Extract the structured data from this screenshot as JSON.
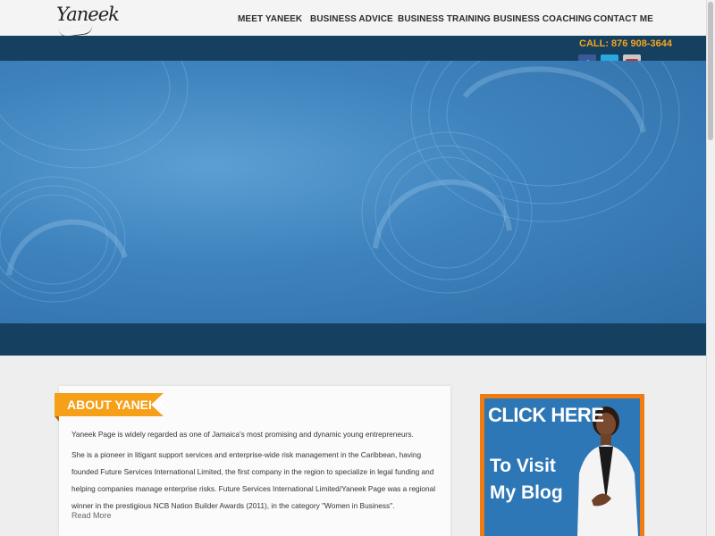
{
  "header": {
    "logo_text": "Yaneek",
    "nav": [
      {
        "label": "MEET YANEEK"
      },
      {
        "label": "BUSINESS ADVICE"
      },
      {
        "label": "BUSINESS TRAINING"
      },
      {
        "label": "BUSINESS COACHING"
      },
      {
        "label": "CONTACT ME"
      }
    ]
  },
  "topbar": {
    "phone": "CALL: 876 908-3644",
    "social": [
      {
        "icon": "facebook-icon",
        "glyph": "f"
      },
      {
        "icon": "twitter-icon",
        "glyph": "t"
      },
      {
        "icon": "youtube-icon",
        "glyph": "You"
      }
    ]
  },
  "about": {
    "heading": "ABOUT YANEEK",
    "paragraph1": "Yaneek Page is widely regarded as one of Jamaica's most promising and dynamic young entrepreneurs.",
    "paragraph2": "She is a pioneer in litigant support services and enterprise-wide risk management in the Caribbean, having founded Future Services International Limited, the first company in the region to specialize in legal funding and helping companies manage enterprise risks. Future Services International Limited/Yaneek Page was a regional winner in the prestigious NCB Nation Builder Awards (2011), in the category \"Women in Business\".",
    "read_more": "Read More"
  },
  "blog_banner": {
    "line1": "CLICK HERE",
    "line2": "To Visit",
    "line3": "My Blog"
  },
  "colors": {
    "accent_orange": "#f6a01a",
    "dark_blue": "#15405f",
    "hero_blue": "#3e82bd"
  }
}
